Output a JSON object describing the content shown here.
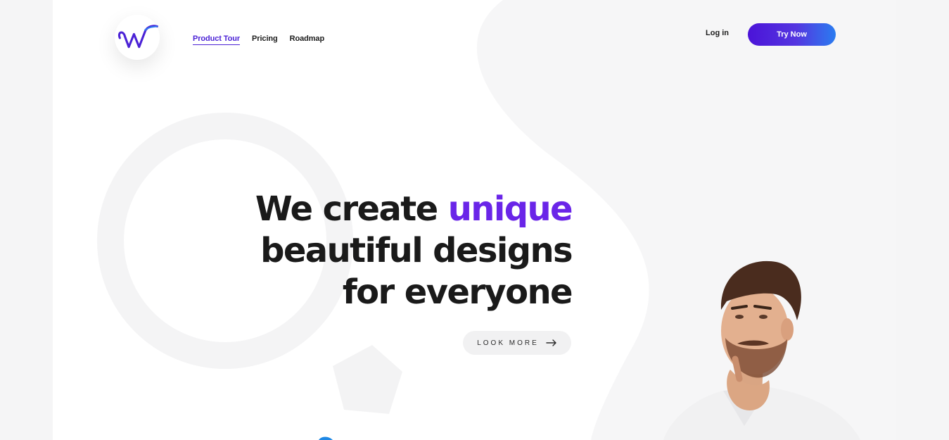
{
  "header": {
    "logo_letter": "W",
    "nav": [
      {
        "label": "Product Tour",
        "active": true
      },
      {
        "label": "Pricing",
        "active": false
      },
      {
        "label": "Roadmap",
        "active": false
      }
    ],
    "login_label": "Log in",
    "cta_label": "Try Now"
  },
  "hero": {
    "line1_prefix": "We create ",
    "line1_accent": "unique",
    "line2": "beautiful designs",
    "line3": "for everyone",
    "cta_label": "LOOK MORE",
    "cta_icon": "arrow-right-icon"
  },
  "colors": {
    "accent": "#6a25e8",
    "button_gradient_start": "#4b13d8",
    "button_gradient_end": "#2a7cf0",
    "page_background": "#f5f5f6"
  }
}
